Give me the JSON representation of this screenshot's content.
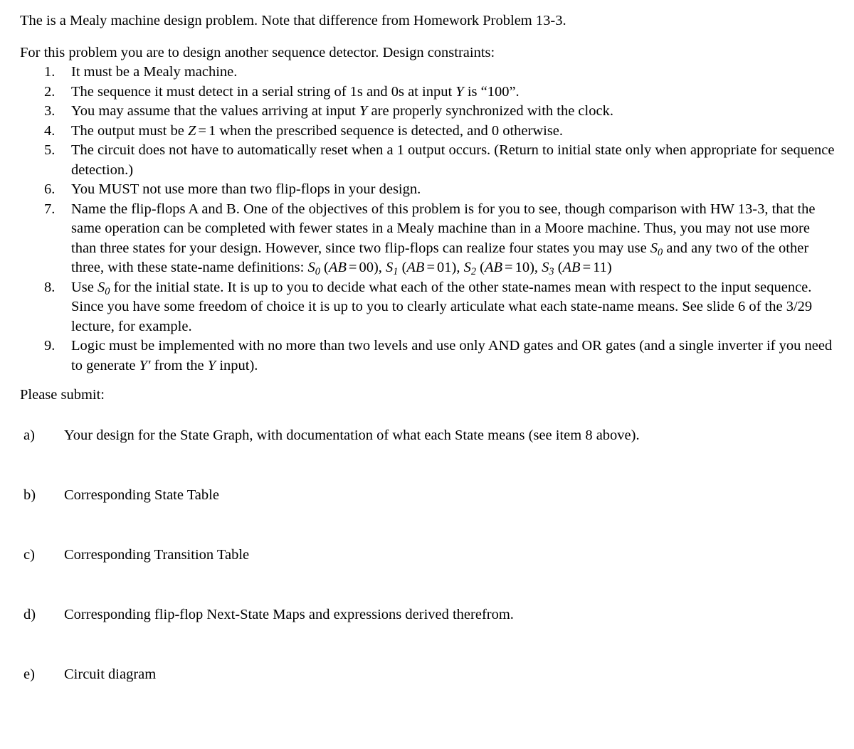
{
  "document": {
    "intro_paragraph": "The is a Mealy machine design problem.  Note that difference from Homework Problem 13-3.",
    "lead_paragraph": "For this problem you are to design another sequence detector.  Design constraints:",
    "constraints": [
      {
        "marker": "1.",
        "text": "It must be a Mealy machine."
      },
      {
        "marker": "2.",
        "text_before": "The sequence it must detect in a serial string of 1s and 0s at input ",
        "var1": "Y",
        "text_after": " is “100”."
      },
      {
        "marker": "3.",
        "text_before": "You may assume that the values arriving at input ",
        "var1": "Y",
        "text_after": " are properly synchronized with the clock."
      },
      {
        "marker": "4.",
        "text_before": "The output must be ",
        "var1": "Z",
        "rel": "=",
        "num1": "1",
        "text_after": " when the prescribed sequence is detected, and 0 otherwise."
      },
      {
        "marker": "5.",
        "text": "The circuit does not have to automatically reset when a 1 output occurs.  (Return to initial state only when appropriate for sequence detection.)"
      },
      {
        "marker": "6.",
        "text": "You MUST not use more than two flip-flops in your design."
      },
      {
        "marker": "7.",
        "text_before": "Name the flip-flops A and B.  One of the objectives of this problem is for you to see, though comparison with HW 13-3, that the same operation can be completed with fewer states in a Mealy machine than in a Moore machine.  Thus, you may not use more than three states for your design.  However, since two flip-flops can realize four states you may use ",
        "var1": "S",
        "var1_sub": "0",
        "text_mid": " and any two of the other three, with these state-name definitions:  ",
        "state_defs": [
          {
            "name": "S",
            "sub": "0",
            "ab": "AB",
            "rel": "=",
            "value": "00",
            "trail": ", "
          },
          {
            "name": "S",
            "sub": "1",
            "ab": "AB",
            "rel": "=",
            "value": "01",
            "trail": ", "
          },
          {
            "name": "S",
            "sub": "2",
            "ab": "AB",
            "rel": "=",
            "value": "10",
            "trail": ", "
          },
          {
            "name": "S",
            "sub": "3",
            "ab": "AB",
            "rel": "=",
            "value": "11",
            "trail": ""
          }
        ]
      },
      {
        "marker": "8.",
        "text_before": "Use ",
        "var1": "S",
        "var1_sub": "0",
        "text_after": " for the initial state.  It is up to you to decide what each of the other state-names mean with respect to the input sequence.  Since you have some freedom of choice it is up to you to clearly articulate what each state-name means.  See slide 6 of the 3/29 lecture, for example."
      },
      {
        "marker": "9.",
        "text_before": "Logic must be implemented with no more than two levels and use only AND gates and OR gates (and a single inverter if you need to generate ",
        "var1": "Y",
        "var1_prime": "′",
        "text_mid": " from the ",
        "var2": "Y",
        "text_after": " input)."
      }
    ],
    "submit_heading": "Please submit:",
    "submit_items": [
      {
        "marker": "a)",
        "text": "Your design for the State Graph, with documentation of what each State means (see item 8 above)."
      },
      {
        "marker": "b)",
        "text": "Corresponding State Table"
      },
      {
        "marker": "c)",
        "text": "Corresponding Transition Table"
      },
      {
        "marker": "d)",
        "text": "Corresponding flip-flop Next-State Maps and expressions derived therefrom."
      },
      {
        "marker": "e)",
        "text": "Circuit diagram"
      }
    ]
  }
}
